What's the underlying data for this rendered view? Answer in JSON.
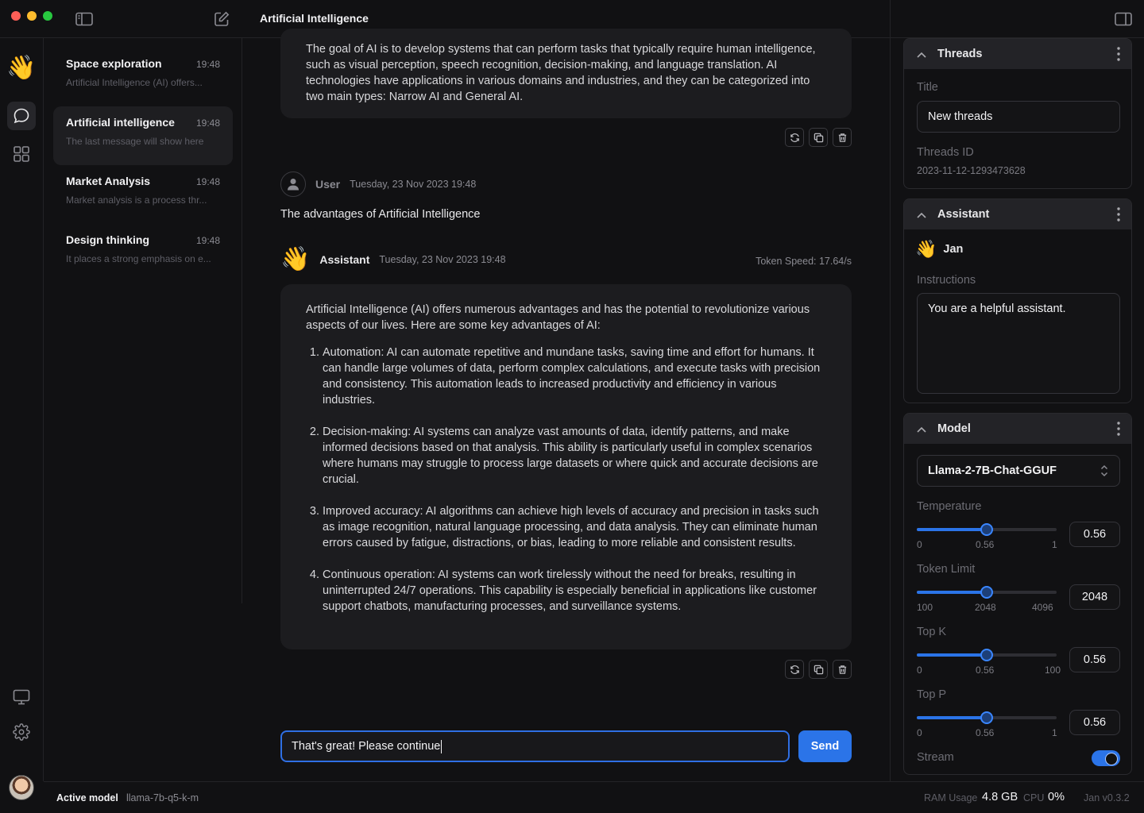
{
  "window": {
    "title": "Artificial Intelligence"
  },
  "threads": [
    {
      "title": "Space exploration",
      "time": "19:48",
      "snippet": "Artificial Intelligence (AI) offers..."
    },
    {
      "title": "Artificial intelligence",
      "time": "19:48",
      "snippet": "The last message will show here"
    },
    {
      "title": "Market Analysis",
      "time": "19:48",
      "snippet": "Market analysis is a process thr..."
    },
    {
      "title": "Design thinking",
      "time": "19:48",
      "snippet": "It places a strong emphasis on e..."
    }
  ],
  "messages": {
    "first_text": "The goal of AI is to develop systems that can perform tasks that typically require human intelligence, such as visual perception, speech recognition, decision-making, and language translation. AI technologies have applications in various domains and industries, and they can be categorized into two main types: Narrow AI and General AI.",
    "user": {
      "name": "User",
      "time": "Tuesday, 23 Nov 2023 19:48",
      "text": "The advantages of Artificial Intelligence"
    },
    "assistant": {
      "name": "Assistant",
      "time": "Tuesday, 23 Nov 2023 19:48",
      "token_speed": "Token Speed: 17.64/s",
      "intro": "Artificial Intelligence (AI) offers numerous advantages and has the potential to revolutionize various aspects of our lives. Here are some key advantages of AI:",
      "points": [
        "Automation: AI can automate repetitive and mundane tasks, saving time and effort for humans. It can handle large volumes of data, perform complex calculations, and execute tasks with precision and consistency. This automation leads to increased productivity and efficiency in various industries.",
        "Decision-making: AI systems can analyze vast amounts of data, identify patterns, and make informed decisions based on that analysis. This ability is particularly useful in complex scenarios where humans may struggle to process large datasets or where quick and accurate decisions are crucial.",
        "Improved accuracy: AI algorithms can achieve high levels of accuracy and precision in tasks such as image recognition, natural language processing, and data analysis. They can eliminate human errors caused by fatigue, distractions, or bias, leading to more reliable and consistent results.",
        "Continuous operation: AI systems can work tirelessly without the need for breaks, resulting in uninterrupted 24/7 operations. This capability is especially beneficial in applications like customer support chatbots, manufacturing processes, and surveillance systems."
      ]
    }
  },
  "composer": {
    "value": "That's great! Please continue",
    "send_label": "Send"
  },
  "panel": {
    "threads": {
      "header": "Threads",
      "title_label": "Title",
      "title_value": "New threads",
      "id_label": "Threads ID",
      "id_value": "2023-11-12-1293473628"
    },
    "assistant": {
      "header": "Assistant",
      "name": "Jan",
      "instructions_label": "Instructions",
      "instructions_value": "You are a helpful assistant."
    },
    "model": {
      "header": "Model",
      "selected": "Llama-2-7B-Chat-GGUF",
      "temperature": {
        "label": "Temperature",
        "min": "0",
        "mid": "0.56",
        "max": "1",
        "value": "0.56",
        "fraction": 0.5
      },
      "token_limit": {
        "label": "Token Limit",
        "min": "100",
        "mid": "2048",
        "max": "4096",
        "value": "2048",
        "fraction": 0.5
      },
      "top_k": {
        "label": "Top K",
        "min": "0",
        "mid": "0.56",
        "max": "100",
        "value": "0.56",
        "fraction": 0.5
      },
      "top_p": {
        "label": "Top P",
        "min": "0",
        "mid": "0.56",
        "max": "1",
        "value": "0.56",
        "fraction": 0.5
      },
      "stream_label": "Stream",
      "stream_on": true
    }
  },
  "status": {
    "active_model_label": "Active model",
    "active_model_value": "llama-7b-q5-k-m",
    "ram_label": "RAM Usage",
    "ram_value": "4.8 GB",
    "cpu_label": "CPU",
    "cpu_value": "0%",
    "version": "Jan v0.3.2"
  },
  "icons": {
    "wave": "👋",
    "accent_color": "#2b74e8"
  }
}
